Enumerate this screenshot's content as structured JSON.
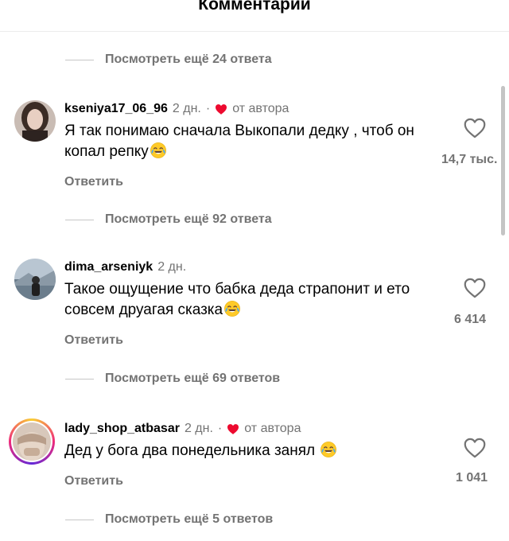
{
  "header": {
    "title": "Комментарии"
  },
  "view_more": [
    "Посмотреть ещё 24 ответа",
    "Посмотреть ещё 92 ответа",
    "Посмотреть ещё 69 ответов",
    "Посмотреть ещё 5 ответов"
  ],
  "comments": [
    {
      "username": "kseniya17_06_96",
      "time": "2 дн.",
      "separator": "·",
      "author_badge": "от автора",
      "text": "Я так понимаю сначала Выкопали дедку , чтоб он копал репку",
      "reply_label": "Ответить",
      "likes": "14,7 тыс."
    },
    {
      "username": "dima_arseniyk",
      "time": "2 дн.",
      "text": "Такое ощущение что бабка деда страпонит и ето совсем друагая сказка",
      "reply_label": "Ответить",
      "likes": "6 414"
    },
    {
      "username": "lady_shop_atbasar",
      "time": "2 дн.",
      "separator": "·",
      "author_badge": "от автора",
      "text": "Дед у бога два понедельника занял ",
      "reply_label": "Ответить",
      "likes": "1 041"
    }
  ],
  "colors": {
    "secondary_text": "#737373",
    "author_heart": "#ed0a2f",
    "story_ring": [
      "#f9ce34",
      "#ee2a7b",
      "#6228d7"
    ]
  },
  "icons": {
    "like": "heart-outline-icon",
    "author_like": "heart-filled-icon",
    "emoji": "tears-of-joy-emoji"
  }
}
